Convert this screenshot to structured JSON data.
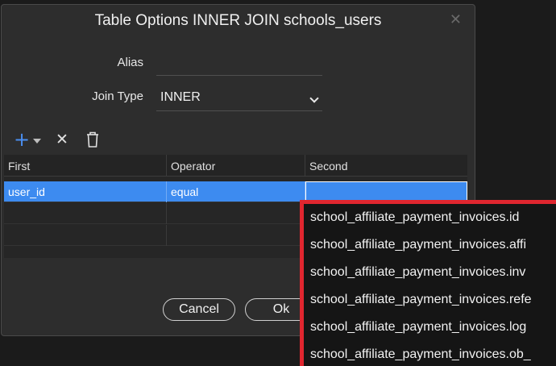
{
  "dialog": {
    "title": "Table Options INNER JOIN schools_users",
    "close_icon": "✕"
  },
  "form": {
    "alias_label": "Alias",
    "alias_value": "",
    "join_type_label": "Join Type",
    "join_type_value": "INNER"
  },
  "toolbar": {
    "add_icon": "+",
    "remove_icon": "✕"
  },
  "grid": {
    "columns": [
      "First",
      "Operator",
      "Second"
    ],
    "rows": [
      [
        "user_id",
        "equal",
        ""
      ]
    ]
  },
  "buttons": {
    "cancel": "Cancel",
    "ok": "Ok"
  },
  "dropdown": {
    "items": [
      "school_affiliate_payment_invoices.id",
      "school_affiliate_payment_invoices.affi",
      "school_affiliate_payment_invoices.inv",
      "school_affiliate_payment_invoices.refe",
      "school_affiliate_payment_invoices.log",
      "school_affiliate_payment_invoices.ob_"
    ]
  },
  "colors": {
    "selection": "#3d8bf0",
    "highlight_border": "#e0262f",
    "add_icon": "#4a8ef0"
  }
}
